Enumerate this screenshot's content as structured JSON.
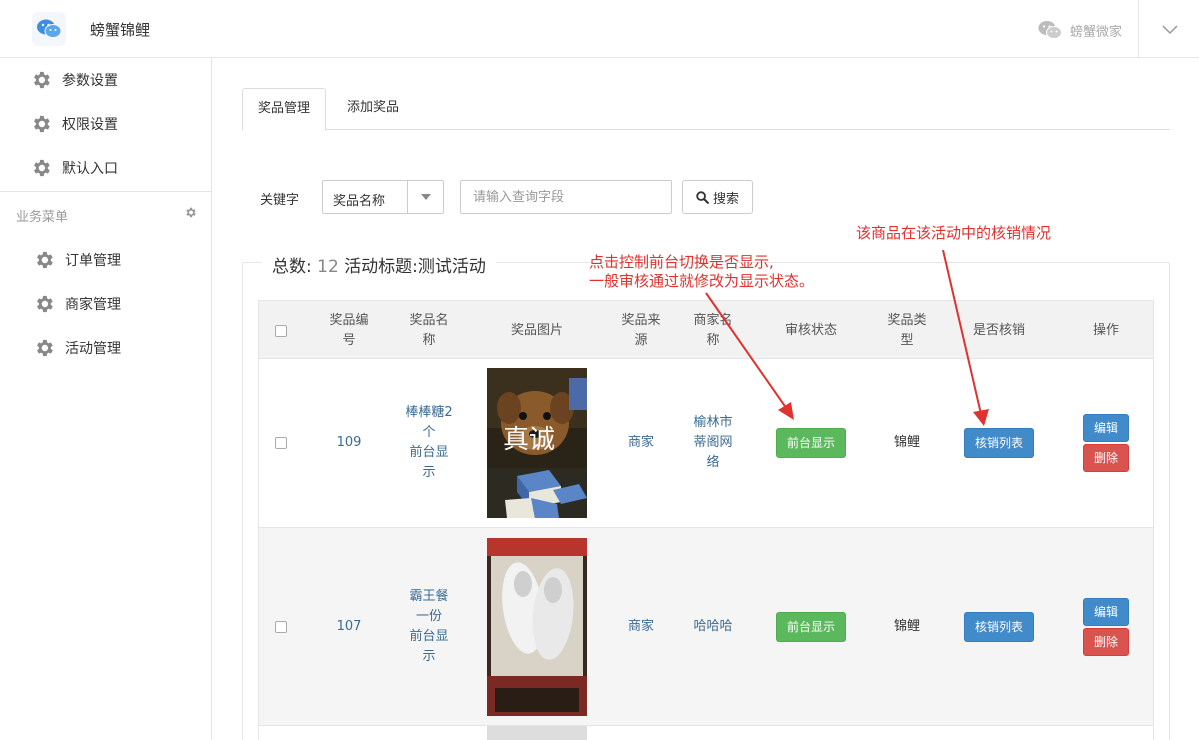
{
  "header": {
    "app_title": "螃蟹锦鲤",
    "account_name": "螃蟹微家"
  },
  "sidebar": {
    "top_items": [
      {
        "label": "参数设置"
      },
      {
        "label": "权限设置"
      },
      {
        "label": "默认入口"
      }
    ],
    "section_title": "业务菜单",
    "business_items": [
      {
        "label": "订单管理"
      },
      {
        "label": "商家管理"
      },
      {
        "label": "活动管理"
      }
    ]
  },
  "tabs": [
    {
      "label": "奖品管理",
      "active": true
    },
    {
      "label": "添加奖品",
      "active": false
    }
  ],
  "search": {
    "keyword_label": "关键字",
    "field_selected": "奖品名称",
    "placeholder": "请输入查询字段",
    "button_label": "搜索"
  },
  "summary": {
    "total_label": "总数:",
    "total": "12",
    "activity_label": "活动标题:",
    "activity_title": "测试活动"
  },
  "table": {
    "headers": [
      "奖品编\n号",
      "奖品名\n称",
      "奖品图片",
      "奖品来\n源",
      "商家名\n称",
      "审核状态",
      "奖品类\n型",
      "是否核销",
      "操作"
    ],
    "rows": [
      {
        "id": "109",
        "name": "棒棒糖2\n个\n前台显\n示",
        "image_caption": "真诚",
        "source": "商家",
        "merchant": "榆林市\n蒂阁网\n络",
        "review_button": "前台显示",
        "type": "锦鲤",
        "verify_button": "核销列表",
        "edit_button": "编辑",
        "delete_button": "删除"
      },
      {
        "id": "107",
        "name": "霸王餐\n一份\n前台显\n示",
        "image_caption": "",
        "source": "商家",
        "merchant": "哈哈哈",
        "review_button": "前台显示",
        "type": "锦鲤",
        "verify_button": "核销列表",
        "edit_button": "编辑",
        "delete_button": "删除"
      }
    ]
  },
  "annotations": {
    "review_note_line1": "点击控制前台切换是否显示,",
    "review_note_line2": "一般审核通过就修改为显示状态。",
    "verify_note": "该商品在该活动中的核销情况"
  },
  "colors": {
    "accent_red": "#e0322f",
    "success_green": "#5cb85c",
    "primary_blue": "#428bca",
    "danger_red": "#d9534f",
    "link_blue": "#3a6a92"
  },
  "icons": [
    "wechat-logo-icon",
    "wechat-icon",
    "chevron-down-icon",
    "gear-icon",
    "caret-down-icon",
    "search-icon"
  ]
}
